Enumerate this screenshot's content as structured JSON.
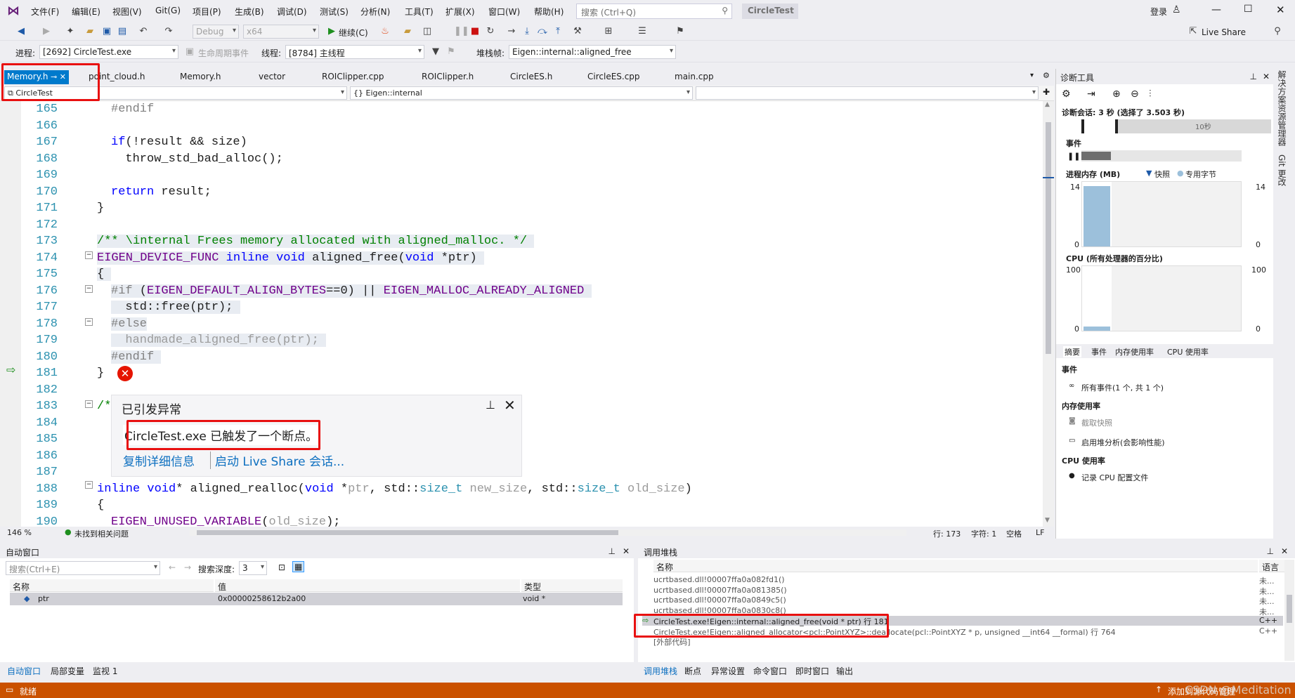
{
  "menu": [
    "文件(F)",
    "编辑(E)",
    "视图(V)",
    "Git(G)",
    "项目(P)",
    "生成(B)",
    "调试(D)",
    "测试(S)",
    "分析(N)",
    "工具(T)",
    "扩展(X)",
    "窗口(W)",
    "帮助(H)"
  ],
  "search_placeholder": "搜索 (Ctrl+Q)",
  "app_title": "CircleTest",
  "login": "登录",
  "live_share": "Live Share",
  "toolbar": {
    "config": "Debug",
    "platform": "x64",
    "continue": "继续(C)"
  },
  "debugbar": {
    "process_label": "进程:",
    "process_value": "[2692] CircleTest.exe",
    "lifecycle": "生命周期事件",
    "thread_label": "线程:",
    "thread_value": "[8784] 主线程",
    "stack_label": "堆栈帧:",
    "stack_value": "Eigen::internal::aligned_free"
  },
  "tabs": [
    "Memory.h",
    "point_cloud.h",
    "Memory.h",
    "vector",
    "ROIClipper.cpp",
    "ROIClipper.h",
    "CircleES.h",
    "CircleES.cpp",
    "main.cpp"
  ],
  "nav": {
    "project": "CircleTest",
    "scope": "{} Eigen::internal"
  },
  "code": [
    {
      "ln": "165",
      "html": "<span class=\"pp\">#endif</span>"
    },
    {
      "ln": "166",
      "html": ""
    },
    {
      "ln": "167",
      "html": "<span class=\"kw\">if</span>(!result &amp;&amp; size)"
    },
    {
      "ln": "168",
      "html": "  throw_std_bad_alloc();"
    },
    {
      "ln": "169",
      "html": ""
    },
    {
      "ln": "170",
      "html": "<span class=\"kw\">return</span> result;"
    },
    {
      "ln": "171",
      "html": "}"
    },
    {
      "ln": "172",
      "html": ""
    },
    {
      "ln": "173",
      "html": "<span class=\"cm hl\">/** \\internal Frees memory allocated with aligned_malloc. */ </span>"
    },
    {
      "ln": "174",
      "html": "<span class=\"hl\"><span class=\"mac\">EIGEN_DEVICE_FUNC</span> <span class=\"kw\">inline</span> <span class=\"kw\">void</span> aligned_free(<span class=\"kw\">void</span> *ptr) </span>"
    },
    {
      "ln": "175",
      "html": "<span class=\"hl\">{ </span>"
    },
    {
      "ln": "176",
      "html": "<span class=\"hl\"><span class=\"pp\">#if</span> (<span class=\"mac\">EIGEN_DEFAULT_ALIGN_BYTES</span>==0) || <span class=\"mac\">EIGEN_MALLOC_ALREADY_ALIGNED</span> </span>"
    },
    {
      "ln": "177",
      "html": "<span class=\"hl\">  std::free(ptr); </span>"
    },
    {
      "ln": "178",
      "html": "<span class=\"hl\"><span class=\"pp\">#else</span></span>"
    },
    {
      "ln": "179",
      "html": "<span class=\"hl gray\">  handmade_aligned_free(ptr); </span>"
    },
    {
      "ln": "180",
      "html": "<span class=\"hl pp\">#endif </span>"
    },
    {
      "ln": "181",
      "html": "}"
    },
    {
      "ln": "182",
      "html": ""
    },
    {
      "ln": "183",
      "html": "<span class=\"cm\">/*</span>"
    },
    {
      "ln": "184",
      "html": ""
    },
    {
      "ln": "185",
      "html": ""
    },
    {
      "ln": "186",
      "html": ""
    },
    {
      "ln": "187",
      "html": ""
    },
    {
      "ln": "188",
      "html": "<span class=\"kw\">inline</span> <span class=\"kw\">void</span>* aligned_realloc(<span class=\"kw\">void</span> *<span class=\"gray\">ptr</span>, std::<span class=\"ty\">size_t</span> <span class=\"gray\">new_size</span>, std::<span class=\"ty\">size_t</span> <span class=\"gray\">old_size</span>)"
    },
    {
      "ln": "189",
      "html": "{"
    },
    {
      "ln": "190",
      "html": "<span class=\"mac\">EIGEN_UNUSED_VARIABLE</span>(<span class=\"gray\">old_size</span>);"
    }
  ],
  "exception": {
    "title": "已引发异常",
    "message": "CircleTest.exe 已触发了一个断点。",
    "copy_details": "复制详细信息",
    "live_share": "启动 Live Share 会话..."
  },
  "editor_status": {
    "zoom": "146 %",
    "issues": "未找到相关问题",
    "line": "行: 173",
    "char": "字符: 1",
    "space": "空格",
    "eol": "LF"
  },
  "diag": {
    "title": "诊断工具",
    "session": "诊断会话: 3 秒 (选择了 3.503 秒)",
    "timeline": "10秒",
    "events": "事件",
    "memory": "进程内存 (MB)",
    "snapshot": "快照",
    "private_bytes": "专用字节",
    "mem_max": "14",
    "mem_min": "0",
    "cpu": "CPU (所有处理器的百分比)",
    "cpu_max": "100",
    "cpu_min": "0",
    "tabs": [
      "摘要",
      "事件",
      "内存使用率",
      "CPU 使用率"
    ],
    "section_events": "事件",
    "all_events": "所有事件(1 个, 共 1 个)",
    "section_memory": "内存使用率",
    "take_snapshot": "截取快照",
    "heap_profile": "启用堆分析(会影响性能)",
    "section_cpu": "CPU 使用率",
    "record_cpu": "记录 CPU 配置文件"
  },
  "side_tabs": [
    "解决方案资源管理器",
    "Git 更改"
  ],
  "autos": {
    "title": "自动窗口",
    "search": "搜索(Ctrl+E)",
    "depth_label": "搜索深度:",
    "depth": "3",
    "cols": [
      "名称",
      "值",
      "类型"
    ],
    "rows": [
      {
        "name": "ptr",
        "value": "0x00000258612b2a00",
        "type": "void *"
      }
    ],
    "tabs": [
      "自动窗口",
      "局部变量",
      "监视 1"
    ]
  },
  "callstack": {
    "title": "调用堆栈",
    "cols": [
      "名称",
      "语言"
    ],
    "rows": [
      {
        "name": "ucrtbased.dll!00007ffa0a082fd1()",
        "lang": "未..."
      },
      {
        "name": "ucrtbased.dll!00007ffa0a081385()",
        "lang": "未..."
      },
      {
        "name": "ucrtbased.dll!00007ffa0a0849c5()",
        "lang": "未..."
      },
      {
        "name": "ucrtbased.dll!00007ffa0a0830c8()",
        "lang": "未..."
      },
      {
        "name": "CircleTest.exe!Eigen::internal::aligned_free(void * ptr) 行 181",
        "lang": "C++"
      },
      {
        "name": "CircleTest.exe!Eigen::aligned_allocator<pcl::PointXYZ>::deallocate(pcl::PointXYZ * p, unsigned __int64 __formal) 行 764",
        "lang": "C++"
      },
      {
        "name": "[外部代码]",
        "lang": ""
      }
    ],
    "tabs": [
      "调用堆栈",
      "断点",
      "异常设置",
      "命令窗口",
      "即时窗口",
      "输出"
    ]
  },
  "status": {
    "ready": "就绪",
    "source_control": "添加到源代码管理",
    "watermark": "CSDN @Meditation"
  }
}
